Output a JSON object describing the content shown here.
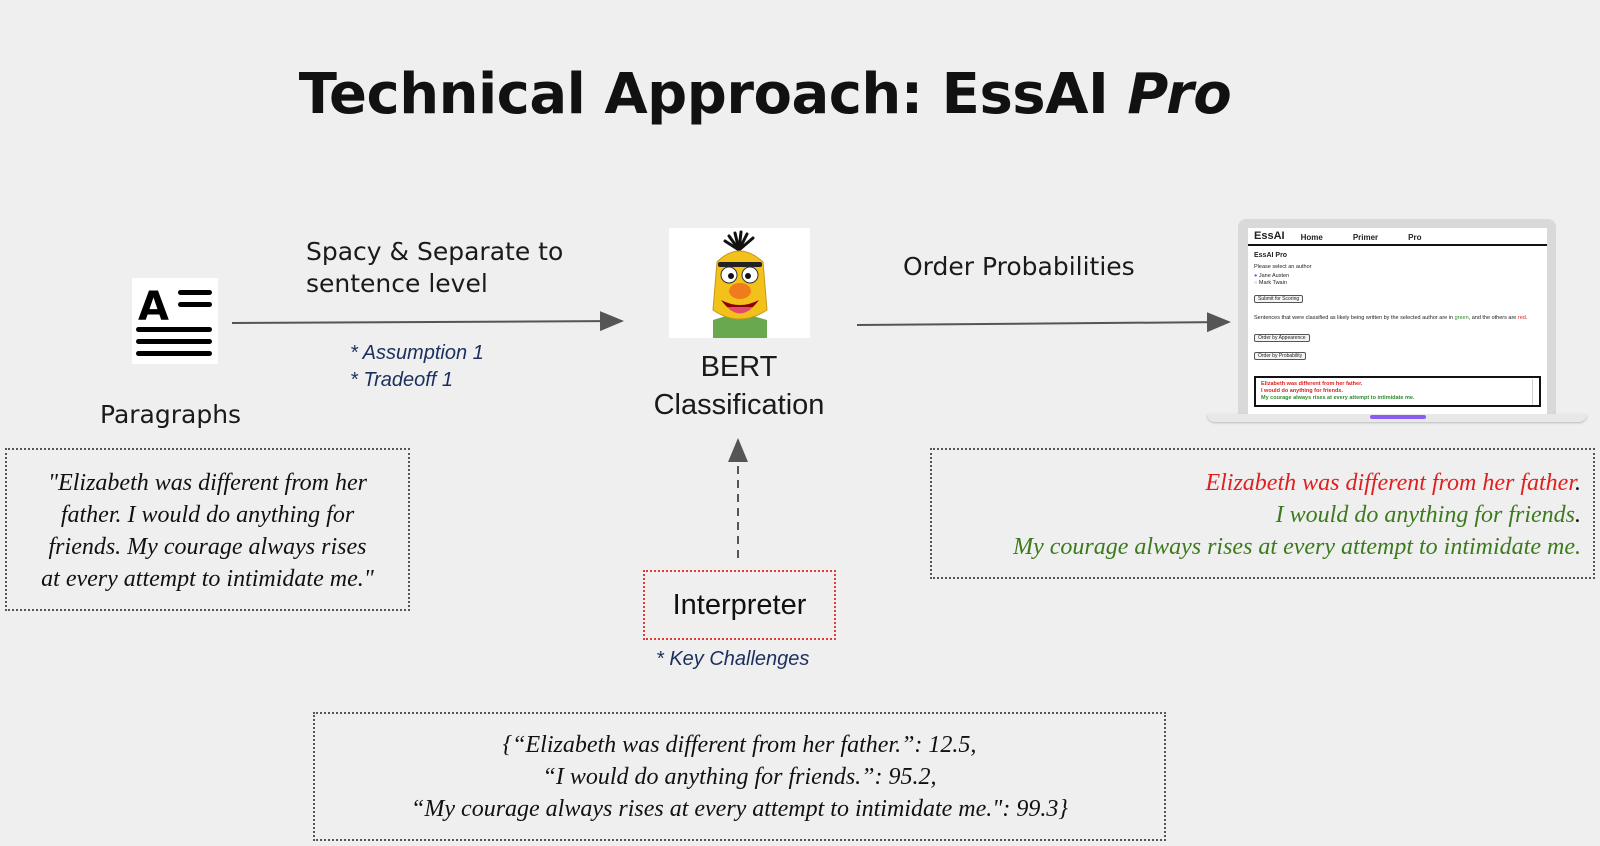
{
  "title": {
    "main": "Technical Approach: EssAI",
    "italic": "Pro"
  },
  "input": {
    "label": "Paragraphs",
    "icon": "text-align-icon",
    "paragraph": [
      "\"Elizabeth was different from her",
      "father. I would do anything for",
      "friends. My courage always rises",
      "at every attempt to intimidate me.\""
    ]
  },
  "step1": {
    "label_lines": [
      "Spacy & Separate to",
      "sentence level"
    ],
    "notes": [
      "* Assumption 1",
      "* Tradeoff 1"
    ]
  },
  "model": {
    "label_lines": [
      "BERT",
      "Classification"
    ],
    "icon": "bert-muppet-icon"
  },
  "step2": {
    "label": "Order Probabilities"
  },
  "interpreter": {
    "label": "Interpreter",
    "note": "* Key Challenges"
  },
  "scores": [
    "{“Elizabeth was different from her father.”: 12.5,",
    "“I would do anything for friends.”: 95.2,",
    "“My courage always rises at every attempt to intimidate me.\": 99.3}"
  ],
  "output": [
    {
      "text": "Elizabeth was different from her father",
      "suffix": ".",
      "color": "#e02020"
    },
    {
      "text": "I would do anything for friends",
      "suffix": ".",
      "color": "#3c7a1e"
    },
    {
      "text": "My courage always rises at every attempt to intimidate me.",
      "suffix": "",
      "color": "#3c7a1e"
    }
  ],
  "screenshot": {
    "brand": "EssAI",
    "nav": [
      "Home",
      "Primer",
      "Pro"
    ],
    "heading": "EssAI Pro",
    "prompt": "Please select an author",
    "authors": [
      "Jane Austen",
      "Mark Twain"
    ],
    "submit": "Submit for Scoring",
    "desc_a": "Sentences that were classified as likely being written by the selected author are in ",
    "desc_green": "green",
    "desc_b": ", and the others are ",
    "desc_red": "red",
    "desc_c": ".",
    "order_buttons": [
      "Order by Appearence",
      "Order by Probability"
    ],
    "results": [
      {
        "text": "Elizabeth was different from her father.",
        "color": "#e02020"
      },
      {
        "text": "I would do anything for friends.",
        "color": "#e02020"
      },
      {
        "text": "My courage always rises at every attempt to intimidate me.",
        "color": "#2e8b2e"
      }
    ]
  }
}
